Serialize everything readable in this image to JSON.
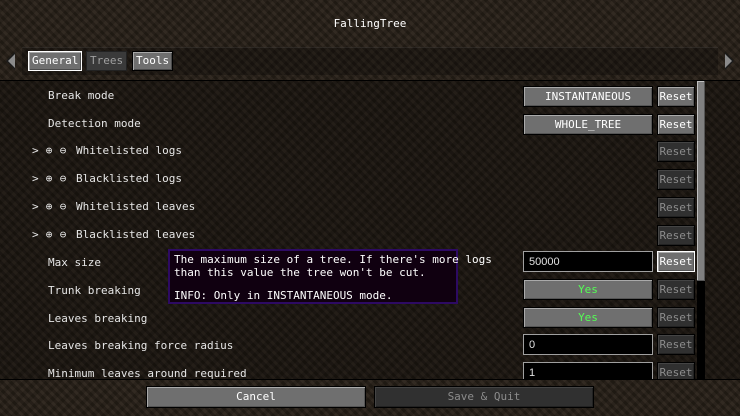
{
  "title": "FallingTree",
  "tabs": [
    {
      "label": "General",
      "state": "active"
    },
    {
      "label": "Trees",
      "state": "inactive"
    },
    {
      "label": "Tools",
      "state": "normal"
    }
  ],
  "icons": {
    "expand": ">",
    "add": "⊕",
    "remove": "⊖"
  },
  "rows": {
    "break_mode": {
      "label": "Break mode",
      "value": "INSTANTANEOUS",
      "reset": "Reset"
    },
    "detection_mode": {
      "label": "Detection mode",
      "value": "WHOLE_TREE",
      "reset": "Reset"
    },
    "whitelisted_logs": {
      "label": "Whitelisted logs",
      "reset": "Reset"
    },
    "blacklisted_logs": {
      "label": "Blacklisted logs",
      "reset": "Reset"
    },
    "whitelisted_leaves": {
      "label": "Whitelisted leaves",
      "reset": "Reset"
    },
    "blacklisted_leaves": {
      "label": "Blacklisted leaves",
      "reset": "Reset"
    },
    "max_size": {
      "label": "Max size",
      "value": "50000",
      "reset": "Reset"
    },
    "trunk_breaking": {
      "label": "Trunk breaking",
      "value": "Yes",
      "reset": "Reset"
    },
    "leaves_breaking": {
      "label": "Leaves breaking",
      "value": "Yes",
      "reset": "Reset"
    },
    "leaves_breaking_force_radius": {
      "label": "Leaves breaking force radius",
      "value": "0",
      "reset": "Reset"
    },
    "minimum_leaves_around_required": {
      "label": "Minimum leaves around required",
      "value": "1",
      "reset": "Reset"
    }
  },
  "tooltip": {
    "line1": "The maximum size of a tree. If there's more logs",
    "line2": "than this value the tree won't be cut.",
    "info": "INFO: Only in INSTANTANEOUS mode."
  },
  "footer": {
    "cancel": "Cancel",
    "save": "Save & Quit"
  },
  "colors": {
    "yes_value": "#55ff55",
    "tooltip_border": "#2d0a63",
    "tooltip_bg": "#100010"
  }
}
